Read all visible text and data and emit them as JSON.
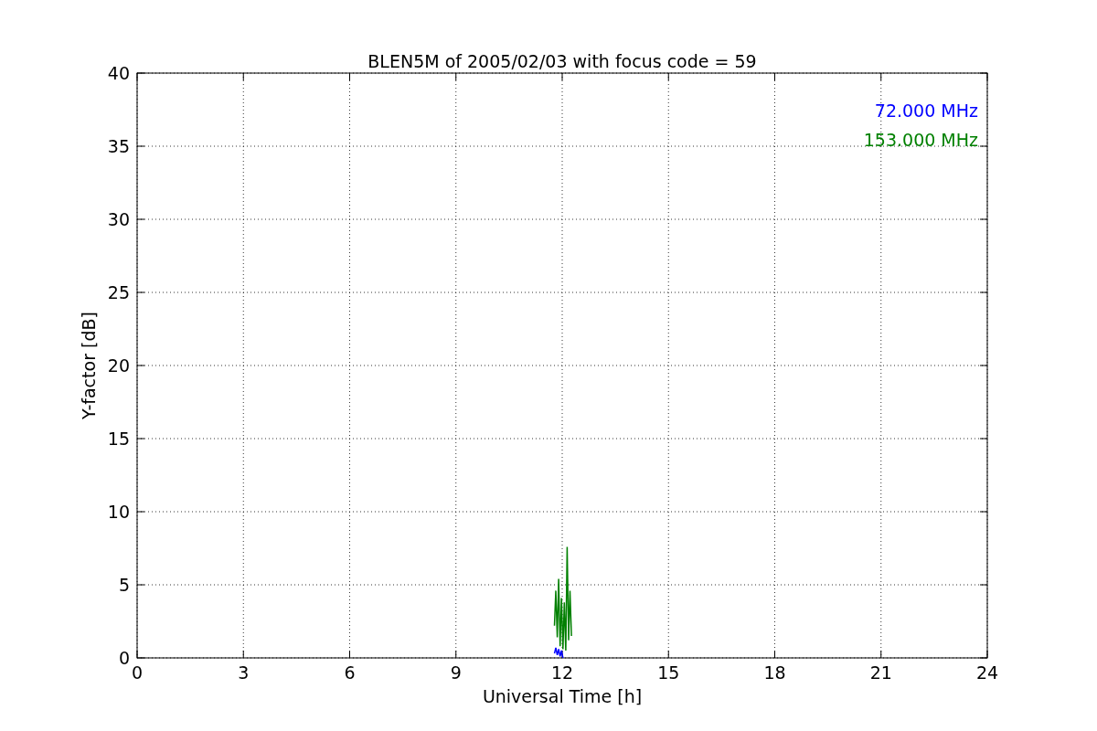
{
  "chart_data": {
    "type": "line",
    "title": "BLEN5M of 2005/02/03 with focus code = 59",
    "xlabel": "Universal Time [h]",
    "ylabel": "Y-factor [dB]",
    "x": [
      11.78,
      11.82,
      11.86,
      11.9,
      11.94,
      11.98,
      12.02,
      12.06,
      12.1,
      12.14,
      12.18,
      12.22,
      12.26
    ],
    "series": [
      {
        "name": "72.000 MHz",
        "color": "#0000ff",
        "values": [
          0.3,
          0.7,
          0.2,
          0.6,
          0.1,
          0.5,
          0.0,
          null,
          null,
          null,
          null,
          null,
          null
        ]
      },
      {
        "name": "153.000 MHz",
        "color": "#008000",
        "values": [
          2.2,
          4.6,
          1.4,
          5.4,
          0.8,
          4.1,
          0.6,
          3.8,
          0.5,
          7.6,
          1.2,
          4.6,
          1.5
        ]
      }
    ],
    "xlim": [
      0,
      24
    ],
    "ylim": [
      0,
      40
    ],
    "xticks": [
      0,
      3,
      6,
      9,
      12,
      15,
      18,
      21,
      24
    ],
    "yticks": [
      0,
      5,
      10,
      15,
      20,
      25,
      30,
      35,
      40
    ],
    "grid": true
  }
}
